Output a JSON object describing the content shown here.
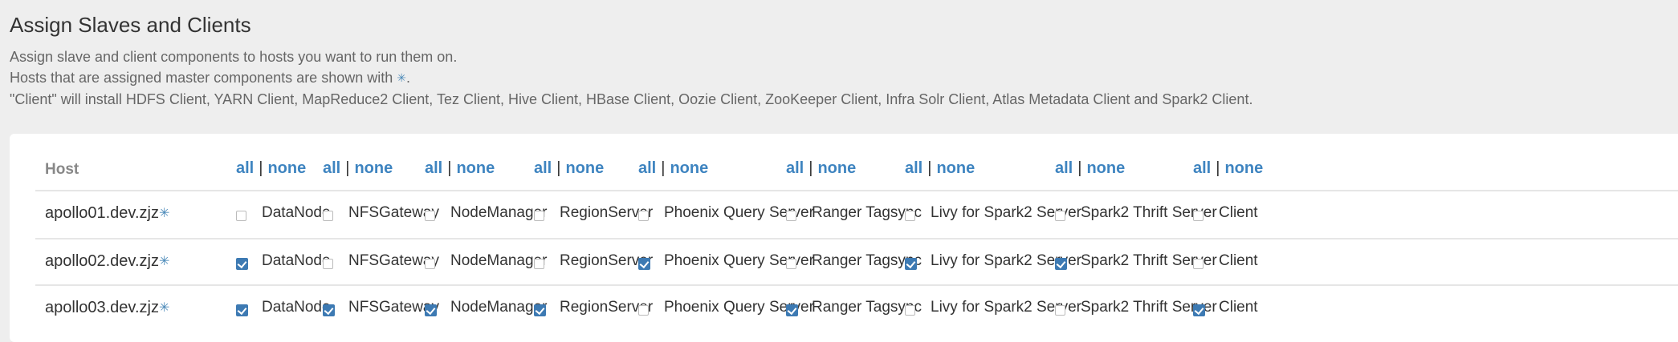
{
  "page": {
    "title": "Assign Slaves and Clients",
    "desc_line1": "Assign slave and client components to hosts you want to run them on.",
    "desc_line2_prefix": "Hosts that are assigned master components are shown with",
    "desc_line2_suffix": ".",
    "desc_line3": "\"Client\" will install HDFS Client, YARN Client, MapReduce2 Client, Tez Client, Hive Client, HBase Client, Oozie Client, ZooKeeper Client, Infra Solr Client, Atlas Metadata Client and Spark2 Client.",
    "master_glyph": "✳"
  },
  "table": {
    "host_header": "Host",
    "all_label": "all",
    "none_label": "none",
    "separator": "|",
    "components": [
      "DataNode",
      "NFSGateway",
      "NodeManager",
      "RegionServer",
      "Phoenix Query Server",
      "Ranger Tagsync",
      "Livy for Spark2 Server",
      "Spark2 Thrift Server",
      "Client"
    ],
    "rows": [
      {
        "host": "apollo01.dev.zjz",
        "master_icon": "✳",
        "checked": [
          false,
          false,
          false,
          false,
          false,
          false,
          false,
          false,
          false
        ]
      },
      {
        "host": "apollo02.dev.zjz",
        "master_icon": "✳",
        "checked": [
          true,
          false,
          false,
          false,
          true,
          false,
          true,
          true,
          false
        ]
      },
      {
        "host": "apollo03.dev.zjz",
        "master_icon": "✳",
        "checked": [
          true,
          true,
          true,
          true,
          false,
          true,
          false,
          false,
          true
        ]
      }
    ]
  },
  "colors": {
    "link": "#3e84c0",
    "checked": "#3d7ab3",
    "master_icon": "#4a89b8"
  }
}
